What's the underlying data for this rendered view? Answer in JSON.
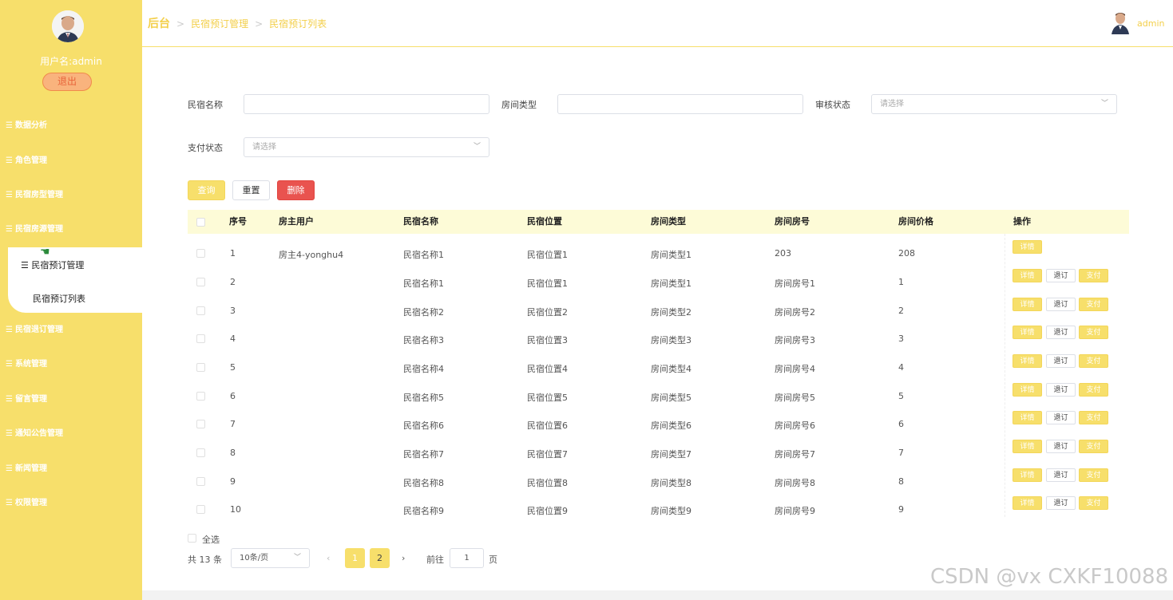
{
  "user": {
    "name_label": "用户名:admin",
    "logout": "退出",
    "top_name": "admin"
  },
  "breadcrumb": {
    "root": "后台",
    "level1": "民宿预订管理",
    "level2": "民宿预订列表"
  },
  "menu": {
    "top": [
      "数据分析",
      "角色管理",
      "民宿房型管理",
      "民宿房源管理"
    ],
    "active": "民宿预订管理",
    "active_sub": "民宿预订列表",
    "bottom": [
      "民宿退订管理",
      "系统管理",
      "留言管理",
      "通知公告管理",
      "新闻管理",
      "权限管理"
    ]
  },
  "filters": {
    "name_label": "民宿名称",
    "name_value": "",
    "type_label": "房间类型",
    "type_value": "",
    "audit_label": "审核状态",
    "audit_placeholder": "请选择",
    "pay_label": "支付状态",
    "pay_placeholder": "请选择"
  },
  "actions": {
    "query": "查询",
    "reset": "重置",
    "delete": "删除"
  },
  "table": {
    "headers": [
      "序号",
      "房主用户",
      "民宿名称",
      "民宿位置",
      "房间类型",
      "房间房号",
      "房间价格",
      "操作"
    ],
    "rows": [
      [
        "1",
        "房主4-yonghu4",
        "民宿名称1",
        "民宿位置1",
        "房间类型1",
        "203",
        "208"
      ],
      [
        "2",
        "",
        "民宿名称1",
        "民宿位置1",
        "房间类型1",
        "房间房号1",
        "1"
      ],
      [
        "3",
        "",
        "民宿名称2",
        "民宿位置2",
        "房间类型2",
        "房间房号2",
        "2"
      ],
      [
        "4",
        "",
        "民宿名称3",
        "民宿位置3",
        "房间类型3",
        "房间房号3",
        "3"
      ],
      [
        "5",
        "",
        "民宿名称4",
        "民宿位置4",
        "房间类型4",
        "房间房号4",
        "4"
      ],
      [
        "6",
        "",
        "民宿名称5",
        "民宿位置5",
        "房间类型5",
        "房间房号5",
        "5"
      ],
      [
        "7",
        "",
        "民宿名称6",
        "民宿位置6",
        "房间类型6",
        "房间房号6",
        "6"
      ],
      [
        "8",
        "",
        "民宿名称7",
        "民宿位置7",
        "房间类型7",
        "房间房号7",
        "7"
      ],
      [
        "9",
        "",
        "民宿名称8",
        "民宿位置8",
        "房间类型8",
        "房间房号8",
        "8"
      ],
      [
        "10",
        "",
        "民宿名称9",
        "民宿位置9",
        "房间类型9",
        "房间房号9",
        "9"
      ]
    ],
    "row_buttons": {
      "detail": "详情",
      "cancel": "退订",
      "pay": "支付"
    }
  },
  "footer": {
    "select_all": "全选",
    "total": "共 13 条",
    "page_size": "10条/页",
    "pages": [
      "1",
      "2"
    ],
    "goto_label": "前往",
    "goto_value": "1",
    "page_unit": "页"
  },
  "watermark": "CSDN @vx CXKF10088",
  "colors": {
    "accent": "#f7df6b",
    "danger": "#e9534f",
    "header_bg": "#fdfbd7"
  }
}
